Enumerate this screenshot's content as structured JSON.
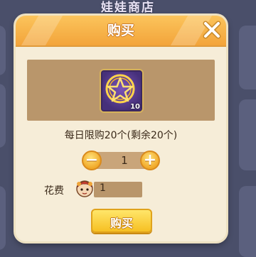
{
  "background": {
    "shop_title": "娃娃商店"
  },
  "dialog": {
    "title": "购买",
    "close_icon": "close-x-icon",
    "item": {
      "icon": "pentagram-icon",
      "count": "10"
    },
    "limit_text": "每日限购20个(剩余20个)",
    "quantity": {
      "value": "1",
      "minus_symbol": "−",
      "plus_symbol": "+"
    },
    "cost": {
      "label": "花费",
      "currency_icon": "doll-coin-icon",
      "value": "1"
    },
    "buy_button_label": "购买"
  },
  "colors": {
    "header": "#f3a43a",
    "panel": "#f6edd8",
    "item_area": "#b9966b",
    "button": "#f6c023"
  }
}
